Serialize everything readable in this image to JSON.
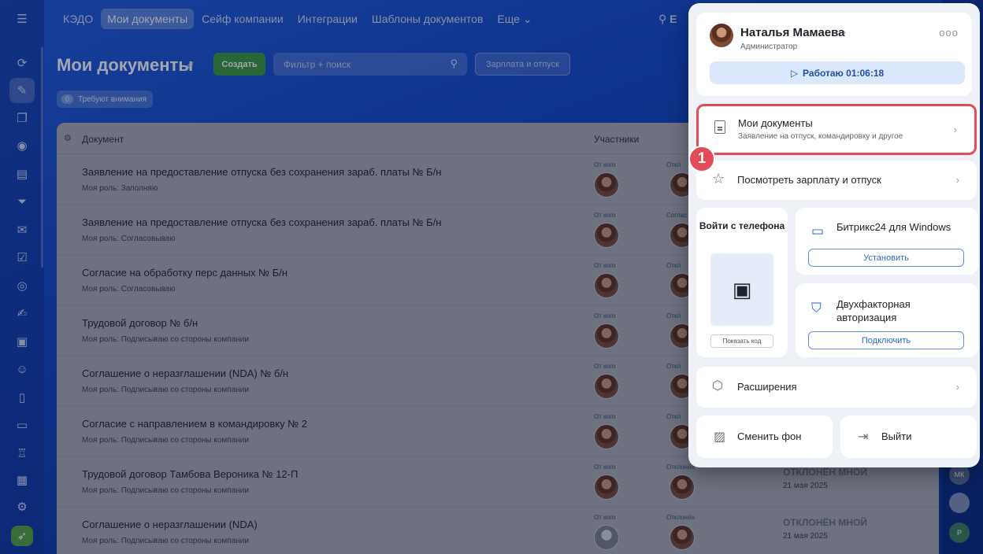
{
  "nav": {
    "menu_icon": "hamburger-icon",
    "items": [
      {
        "label": "КЭДО"
      },
      {
        "label": "Мои документы"
      },
      {
        "label": "Сейф компании"
      },
      {
        "label": "Интеграции"
      },
      {
        "label": "Шаблоны документов"
      },
      {
        "label": "Еще"
      }
    ],
    "search_letter": "E"
  },
  "page": {
    "title": "Мои документы",
    "create_label": "Создать",
    "filter_placeholder": "Фильтр + поиск",
    "salary_label": "Зарплата и отпуск",
    "attention_count": "0",
    "attention_label": "Требуют внимания"
  },
  "table": {
    "col_document": "Документ",
    "col_participants": "Участники",
    "rows": [
      {
        "title": "Заявление на предоставление отпуска без сохранения зараб. платы № Б/н",
        "role": "Моя роль: Заполняю",
        "from": "От кого",
        "second": "Откл",
        "status": "",
        "date": ""
      },
      {
        "title": "Заявление на предоставление отпуска без сохранения зараб. платы № Б/н",
        "role": "Моя роль: Согласовываю",
        "from": "От кого",
        "second": "Соглас",
        "status": "",
        "date": ""
      },
      {
        "title": "Согласие на обработку перс данных № Б/н",
        "role": "Моя роль: Согласовываю",
        "from": "От кого",
        "second": "Откл",
        "status": "",
        "date": ""
      },
      {
        "title": "Трудовой договор № б/н",
        "role": "Моя роль: Подписываю со стороны компании",
        "from": "От кого",
        "second": "Откл",
        "status": "",
        "date": ""
      },
      {
        "title": "Соглашение о неразглашении (NDA) № б/н",
        "role": "Моя роль: Подписываю со стороны компании",
        "from": "От кого",
        "second": "Откл",
        "status": "",
        "date": ""
      },
      {
        "title": "Согласие с направлением в командировку № 2",
        "role": "Моя роль: Подписываю со стороны компании",
        "from": "От кого",
        "second": "Откл",
        "status": "",
        "date": ""
      },
      {
        "title": "Трудовой договор Тамбова Вероника № 12-П",
        "role": "Моя роль: Подписываю со стороны компании",
        "from": "От кого",
        "second": "Отклонён",
        "status": "ОТКЛОНЁН МНОЙ",
        "date": "21 мая 2025"
      },
      {
        "title": "Соглашение о неразглашении (NDA)",
        "role": "Моя роль: Подписываю со стороны компании",
        "from": "От кого",
        "second": "Отклонён",
        "status": "ОТКЛОНЁН МНОЙ",
        "date": "21 мая 2025"
      }
    ]
  },
  "rightstrip": {
    "badge": "МК",
    "badge2": "Р"
  },
  "popup": {
    "user_name": "Наталья Мамаева",
    "user_role": "Администратор",
    "work_label": "Работаю 01:06:18",
    "my_docs_title": "Мои документы",
    "my_docs_sub": "Заявление на отпуск, командировку и другое",
    "step": "1",
    "salary_label": "Посмотреть зарплату и отпуск",
    "phone_title": "Войти с телефона",
    "show_code": "Показать код",
    "win_title": "Битрикс24 для Windows",
    "install_label": "Установить",
    "tfa_title": "Двухфакторная авторизация",
    "connect_label": "Подключить",
    "extensions_label": "Расширения",
    "change_bg_label": "Сменить фон",
    "logout_label": "Выйти"
  },
  "colors": {
    "accent_green": "#3d9b39",
    "highlight_red": "#e24b58",
    "link_blue": "#2a67c9"
  }
}
